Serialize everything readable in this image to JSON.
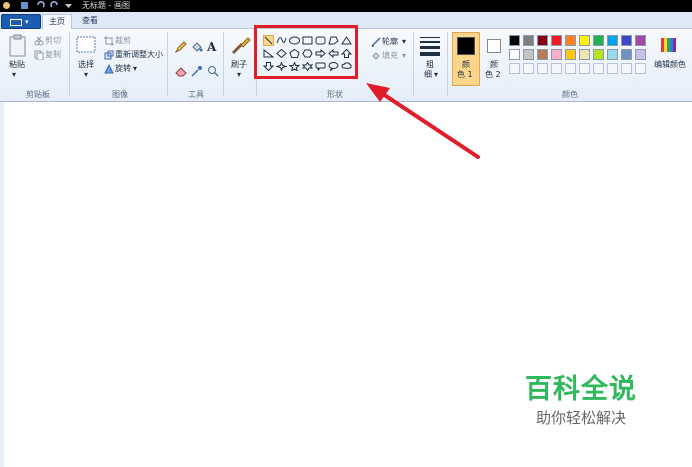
{
  "window": {
    "title": "无标题 - 画图"
  },
  "tabs": [
    {
      "label": "主页",
      "active": true
    },
    {
      "label": "查看",
      "active": false
    }
  ],
  "clipboard": {
    "paste_label": "粘贴",
    "cut_label": "剪切",
    "copy_label": "复制",
    "group_label": "剪贴板"
  },
  "image": {
    "select_label": "选择",
    "crop_label": "裁剪",
    "resize_label": "重新调整大小",
    "rotate_label": "旋转",
    "group_label": "图像"
  },
  "tools": {
    "group_label": "工具"
  },
  "brushes": {
    "label": "刷子"
  },
  "shapes": {
    "outline_label": "轮廓",
    "fill_label": "填充",
    "group_label": "形状"
  },
  "size": {
    "label_line1": "粗",
    "label_line2": "细"
  },
  "colors": {
    "color1_label_line1": "颜",
    "color1_label_line2": "色 1",
    "color2_label_line1": "颜",
    "color2_label_line2": "色 2",
    "edit_label": "编辑颜色",
    "group_label": "颜色",
    "color1": "#000000",
    "color2": "#ffffff",
    "palette_row1": [
      "#000000",
      "#7f7f7f",
      "#880015",
      "#ed1c24",
      "#ff7f27",
      "#fff200",
      "#22b14c",
      "#00a2e8",
      "#3f48cc",
      "#a349a4"
    ],
    "palette_row2": [
      "#ffffff",
      "#c3c3c3",
      "#b97a57",
      "#ffaec9",
      "#ffc90e",
      "#efe4b0",
      "#b5e61d",
      "#99d9ea",
      "#7092be",
      "#c8bfe7"
    ]
  },
  "annotation": {
    "box_color": "#e21d2a",
    "arrow_color": "#e21d2a"
  },
  "watermark": {
    "title": "百科全说",
    "subtitle": "助你轻松解决"
  }
}
